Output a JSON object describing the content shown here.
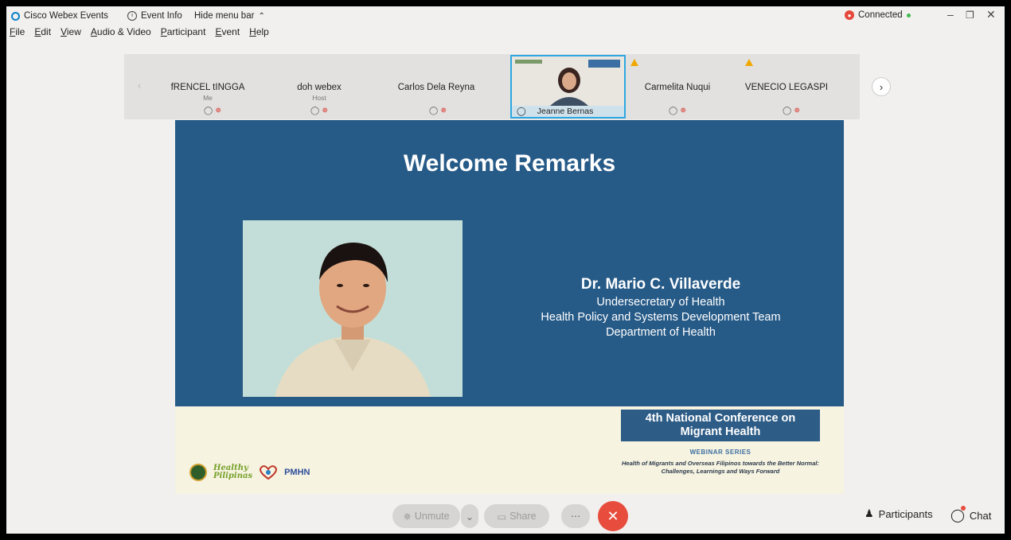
{
  "titlebar": {
    "app_name": "Cisco Webex Events",
    "event_info": "Event Info",
    "hide_menu": "Hide menu bar",
    "connection_status": "Connected"
  },
  "menubar": [
    "File",
    "Edit",
    "View",
    "Audio & Video",
    "Participant",
    "Event",
    "Help"
  ],
  "participants": [
    {
      "name": "fRENCEL tINGGA",
      "role": "Me"
    },
    {
      "name": "doh webex",
      "role": "Host"
    },
    {
      "name": "Carlos Dela Reyna",
      "role": ""
    },
    {
      "name": "Jeanne Bernas",
      "role": ""
    },
    {
      "name": "Carmelita Nuqui",
      "role": ""
    },
    {
      "name": "VENECIO LEGASPI",
      "role": ""
    }
  ],
  "slide": {
    "title": "Welcome Remarks",
    "speaker_name": "Dr. Mario C. Villaverde",
    "speaker_lines": [
      "Undersecretary of Health",
      "Health Policy and Systems Development Team",
      "Department of Health"
    ],
    "conference_line1": "4th National Conference on",
    "conference_line2": "Migrant Health",
    "webinar_series": "WEBINAR SERIES",
    "subtitle_line1": "Health of Migrants and Overseas Filipinos towards the Better Normal:",
    "subtitle_line2": "Challenges, Learnings and Ways Forward",
    "logo_healthy": "Healthy",
    "logo_pilipinas": "Pilipinas",
    "logo_pmhn": "PMHN"
  },
  "controls": {
    "unmute": "Unmute",
    "share": "Share",
    "more": "···",
    "participants": "Participants",
    "chat": "Chat"
  }
}
